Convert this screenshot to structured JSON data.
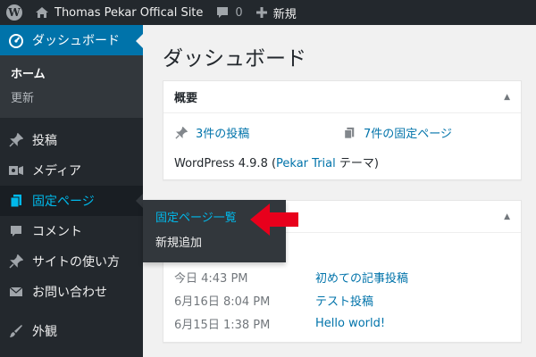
{
  "adminbar": {
    "site_name": "Thomas Pekar Offical Site",
    "comments_count": "0",
    "new_label": "新規"
  },
  "sidebar": {
    "dashboard": "ダッシュボード",
    "submenu": {
      "home": "ホーム",
      "updates": "更新"
    },
    "posts": "投稿",
    "media": "メディア",
    "pages": "固定ページ",
    "comments": "コメント",
    "site_usage": "サイトの使い方",
    "contact": "お問い合わせ",
    "appearance": "外観"
  },
  "flyout": {
    "all_pages": "固定ページ一覧",
    "add_new": "新規追加"
  },
  "main": {
    "title": "ダッシュボード",
    "glance": {
      "heading": "概要",
      "posts": "3件の投稿",
      "pages": "7件の固定ページ",
      "version_prefix": "WordPress 4.9.8 (",
      "theme": "Pekar Trial",
      "version_suffix": " テーマ)"
    },
    "activity": {
      "rows": [
        {
          "date": "今日 4:43 PM",
          "title": "初めての記事投稿"
        },
        {
          "date": "6月16日 8:04 PM",
          "title": "テスト投稿"
        },
        {
          "date": "6月15日 1:38 PM",
          "title": "Hello world!"
        }
      ]
    }
  },
  "colors": {
    "accent": "#0073aa",
    "sidebar": "#23282d",
    "arrow": "#e8001c"
  }
}
